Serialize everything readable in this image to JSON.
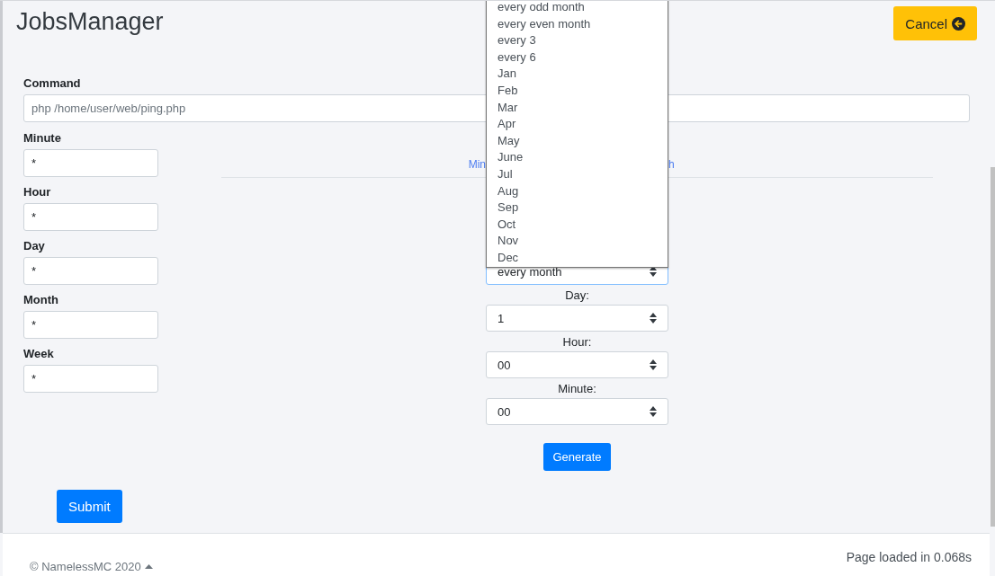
{
  "header": {
    "title": "JobsManager",
    "cancel_button": "Cancel"
  },
  "command": {
    "label": "Command",
    "value": "php /home/user/web/ping.php"
  },
  "fields": [
    {
      "label": "Minute",
      "value": "*"
    },
    {
      "label": "Hour",
      "value": "*"
    },
    {
      "label": "Day",
      "value": "*"
    },
    {
      "label": "Month",
      "value": "*"
    },
    {
      "label": "Week",
      "value": "*"
    }
  ],
  "generator": {
    "tabs": [
      "Min",
      "h"
    ],
    "month_select": {
      "value": "every month",
      "dropdown_options": [
        "every odd month",
        "every even month",
        "every 3",
        "every 6",
        "Jan",
        "Feb",
        "Mar",
        "Apr",
        "May",
        "June",
        "Jul",
        "Aug",
        "Sep",
        "Oct",
        "Nov",
        "Dec"
      ]
    },
    "selects": [
      {
        "label": "Day:",
        "value": "1"
      },
      {
        "label": "Hour:",
        "value": "00"
      },
      {
        "label": "Minute:",
        "value": "00"
      }
    ],
    "generate_button": "Generate"
  },
  "submit_button": "Submit",
  "footer": {
    "copyright": "© NamelessMC 2020",
    "load_time": "Page loaded in 0.068s"
  }
}
